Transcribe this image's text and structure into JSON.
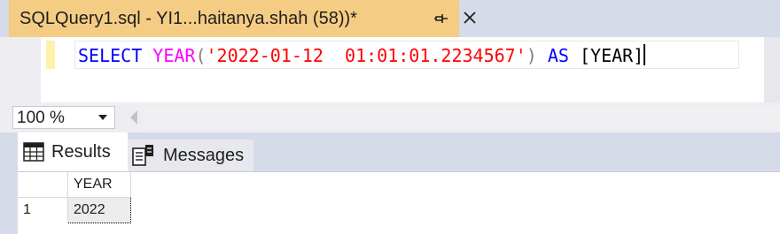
{
  "document_tab": {
    "title": "SQLQuery1.sql - YI1...haitanya.shah (58))*",
    "pin_icon": "pin-icon",
    "close_icon": "close-icon"
  },
  "editor": {
    "tokens": {
      "select": "SELECT",
      "year_fn": "YEAR",
      "open_paren": "(",
      "string_literal": "'2022-01-12  01:01:01.2234567'",
      "close_paren": ")",
      "as": "AS",
      "alias": "[YEAR]"
    }
  },
  "zoom": {
    "value": "100 %",
    "dropdown_icon": "chevron-down-icon"
  },
  "results_tabs": [
    {
      "label": "Results",
      "icon": "grid-icon",
      "selected": true
    },
    {
      "label": "Messages",
      "icon": "messages-icon",
      "selected": false
    }
  ],
  "grid": {
    "columns": [
      "YEAR"
    ],
    "rows": [
      {
        "num": "1",
        "cells": [
          "2022"
        ]
      }
    ]
  },
  "colors": {
    "tab_active": "#f5cc84",
    "keyword": "#0000ff",
    "function": "#ff00ff",
    "string": "#ff0000",
    "operator": "#808080",
    "chrome": "#d6dbe9"
  }
}
